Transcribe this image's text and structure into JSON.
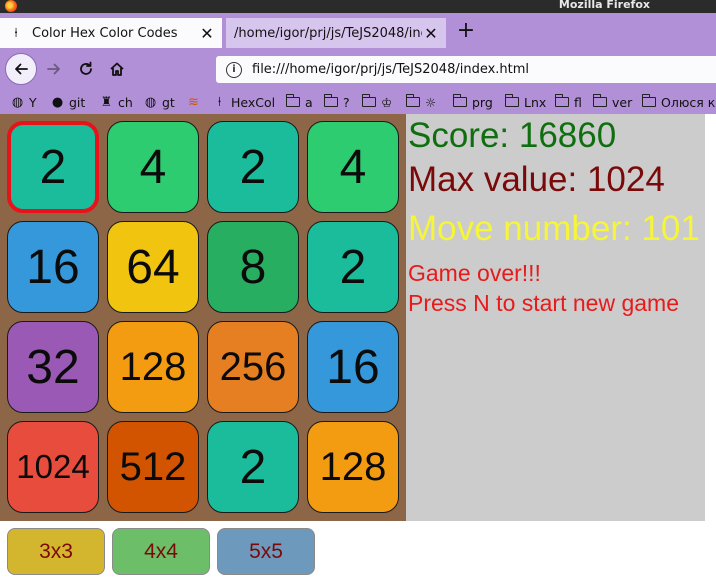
{
  "window": {
    "title": "Mozilla Firefox"
  },
  "tabs": [
    {
      "label": "Color Hex Color Codes",
      "icon": "color-hex-favicon",
      "active": true
    },
    {
      "label": "/home/igor/prj/js/TeJS2048/index",
      "icon": "page-icon",
      "active": false
    }
  ],
  "nav": {
    "url": "file:///home/igor/prj/js/TeJS2048/index.html"
  },
  "bookmarks": [
    {
      "label": "Y",
      "icon": "globe-icon"
    },
    {
      "label": "git",
      "icon": "github-icon"
    },
    {
      "label": "ch",
      "icon": "chess-icon"
    },
    {
      "label": "gt",
      "icon": "globe-icon"
    },
    {
      "label": "",
      "icon": "stack-icon"
    },
    {
      "label": "HexCol",
      "icon": "hexcol-icon"
    },
    {
      "label": "a",
      "icon": "folder-icon"
    },
    {
      "label": "?",
      "icon": "folder-icon"
    },
    {
      "label": "♔",
      "icon": "folder-icon"
    },
    {
      "label": "☼",
      "icon": "folder-icon"
    },
    {
      "label": "prg",
      "icon": "folder-icon"
    },
    {
      "label": "Lnx",
      "icon": "folder-icon"
    },
    {
      "label": "fl",
      "icon": "folder-icon"
    },
    {
      "label": "ver",
      "icon": "folder-icon"
    },
    {
      "label": "Олюся ке",
      "icon": "folder-icon"
    }
  ],
  "game": {
    "tiles": [
      {
        "value": "2",
        "color": "#1abc9c",
        "selected": true
      },
      {
        "value": "4",
        "color": "#2ecc71",
        "selected": false
      },
      {
        "value": "2",
        "color": "#1abc9c",
        "selected": false
      },
      {
        "value": "4",
        "color": "#2ecc71",
        "selected": false
      },
      {
        "value": "16",
        "color": "#3498db",
        "selected": false
      },
      {
        "value": "64",
        "color": "#f1c40f",
        "selected": false
      },
      {
        "value": "8",
        "color": "#27ae60",
        "selected": false
      },
      {
        "value": "2",
        "color": "#1abc9c",
        "selected": false
      },
      {
        "value": "32",
        "color": "#9b59b6",
        "selected": false
      },
      {
        "value": "128",
        "color": "#f39c12",
        "selected": false
      },
      {
        "value": "256",
        "color": "#e67e22",
        "selected": false
      },
      {
        "value": "16",
        "color": "#3498db",
        "selected": false
      },
      {
        "value": "1024",
        "color": "#e74c3c",
        "selected": false
      },
      {
        "value": "512",
        "color": "#d35400",
        "selected": false
      },
      {
        "value": "2",
        "color": "#1abc9c",
        "selected": false
      },
      {
        "value": "128",
        "color": "#f39c12",
        "selected": false
      }
    ],
    "score": "Score: 16860",
    "max_value": "Max value: 1024",
    "move_number": "Move number: 101",
    "game_over": "Game over!!!",
    "new_game_hint": "Press N to start new game",
    "size_buttons": [
      "3x3",
      "4x4",
      "5x5"
    ]
  },
  "colors": {
    "board_bg": "#8c6647",
    "panel_bg": "#cccccc",
    "score": "#0f6f0f",
    "max_value": "#7a0a0a",
    "moves": "#f5f53a",
    "game_over": "#e81a1a",
    "browser_chrome": "#b290d8"
  }
}
